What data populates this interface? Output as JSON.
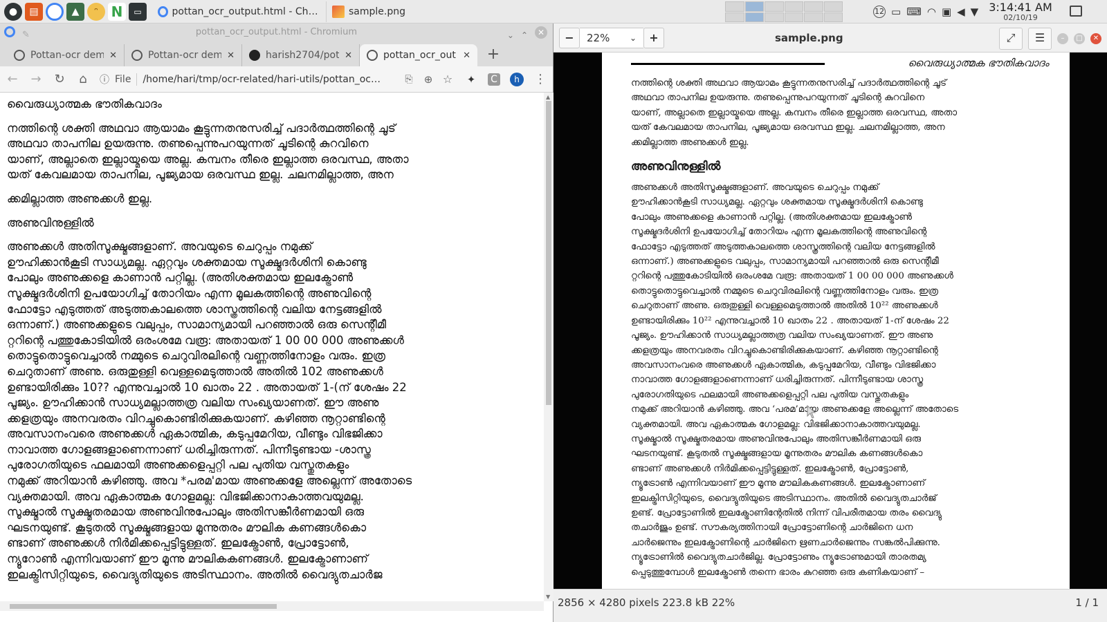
{
  "panel": {
    "tasks": [
      {
        "label": "pottan_ocr_output.html - Chromiu…"
      },
      {
        "label": "sample.png"
      }
    ],
    "battery_label": "12",
    "clock_time": "3:14:41 AM",
    "clock_date": "02/10/19"
  },
  "chromium": {
    "window_title": "pottan_ocr_output.html - Chromium",
    "tabs": [
      {
        "label": "Pottan-ocr dem"
      },
      {
        "label": "Pottan-ocr dem"
      },
      {
        "label": "harish2704/pot"
      },
      {
        "label": "pottan_ocr_out"
      }
    ],
    "scheme_label": "File",
    "url": "/home/hari/tmp/ocr-related/hari-utils/pottan_oc…",
    "avatar_letter": "h",
    "content": {
      "heading": "വൈരുധ്യാത്മക ഭൗതികവാദം",
      "p1": "നത്തിന്റെ ശക്തി അഥവാ ആയാമം കൂട്ടുന്നതനുസരിച്ച് പദാർത്ഥത്തിന്റെ ചൂട്\nഅഥവാ താപനില ഉയരുന്നു. തണുപ്പെന്നുപറയുന്നത് ചൂടിന്റെ കുറവിനെ\nയാണ്, അല്ലാതെ ഇല്ലായ്മയെ അല്ല. കമ്പനം തീരെ ഇല്ലാത്ത ഒരവസ്ഥ, അതാ\nയത് കേവലമായ താപനില, പൂജ്യമായ ഒരവസ്ഥ ഇല്ല. ചലനമില്ലാത്ത, അന",
      "p2": "ക്കമില്ലാത്ത അണുക്കൾ ഇല്ല.",
      "p3": "അണുവിനുള്ളിൽ",
      "p4": "അണുക്കൾ അതിസൂക്ഷ്മങ്ങളാണ്. അവയുടെ ചെറുപ്പം നമുക്ക്\nഊഹിക്കാൻകൂടി സാധ്യമല്ല. ഏറ്റവും ശക്തമായ സൂക്ഷ്മദർശിനി കൊണ്ടു\nപോലും അണുക്കളെ കാണാൻ പറ്റില്ല. (അതിശക്തമായ ഇലക്ട്രോൺ\nസൂക്ഷ്മദർശിനി ഉപയോഗിച്ച് തോറിയം എന്ന മൂലകത്തിന്റെ അണുവിന്റെ\nഫോട്ടോ എടുത്തത് അടുത്തകാലത്തെ ശാസ്ത്രത്തിന്റെ വലിയ നേട്ടങ്ങളിൽ\nഒന്നാണ്.) അണുക്കളുടെ വലുപ്പം, സാമാന്യമായി പറഞ്ഞാൽ ഒരു സെന്റീമീ\nറ്ററിന്റെ പത്തുകോടിയിൽ ഒരംശമേ വരൂ: അതായത് 1 00 00 000 അണുക്കൾ\nതൊട്ടുതൊട്ടുവെച്ചാൽ നമ്മുടെ ചെറുവിരലിന്റെ വണ്ണത്തിനോളം വരും. ഇത്ര\nചെറുതാണ് അണു. ഒരുതുള്ളി വെള്ളമെടുത്താൽ അതിൽ 102 അണുക്കൾ\nഉണ്ടായിരിക്കും 10?? എന്നുവച്ചാൽ 10 ഖാതം 22 . അതായത് 1-(ന് ശേഷം 22\nപൂജ്യം. ഊഹിക്കാൻ സാധ്യമല്ലാത്തത്ര വലിയ സംഖ്യയാണത്. ഈ അണു\nക്കളത്രയും അനവരതം വിറച്ചുകൊണ്ടിരിക്കുകയാണ്. കഴിഞ്ഞ നൂറ്റാണ്ടിന്റെ\nഅവസാനംവരെ അണുക്കൾ ഏകാത്മിക, കടുപ്പമേറിയ, വീണ്ടും വിഭജിക്കാ\nനാവാത്ത ഗോളങ്ങളാണെന്നാണ് ധരിച്ചിരുന്നത്. പിന്നീടുണ്ടായ -ശാസ്ത്ര\nപുരോഗതിയുടെ ഫലമായി അണുക്കളെപ്പറ്റി പല പുതിയ വസ്തുതകളും\nനമുക്ക് അറിയാൻ കഴിഞ്ഞു. അവ *പരമ'മായ അണുക്കളേ അല്ലെന്ന് അതോടെ\nവ്യക്തമായി. അവ ഏകാത്മക ഗോളമല്ല: വിഭജിക്കാനാകാത്തവയുമല്ല.\nസൂക്ഷ്മാൽ സൂക്ഷ്മതരമായ അണുവിനുപോലും അതിസങ്കീർണമായി ഒരു\nഘടനയുണ്ട്. കൂടുതൽ സൂക്ഷ്മങ്ങളായ മൂന്നുതരം മൗലിക കണങ്ങൾകൊ\nണ്ടാണ് അണുക്കൾ നിർമിക്കപ്പെട്ടിട്ടുള്ളത്. ഇലക്ട്രോൺ, പ്രോട്ടോൺ,\nന്യൂറോൺ എന്നിവയാണ് ഈ മൂന്നു മൗലികകണങ്ങൾ. ഇലക്ട്രോണാണ്\nഇലക്ട്രിസിറ്റിയുടെ, വൈദ്യുതിയുടെ അടിസ്ഥാനം. അതിൽ വൈദ്യുതചാർജ"
    }
  },
  "viewer": {
    "zoom": "22%",
    "title": "sample.png",
    "status_info": "2856 × 4280 pixels  223.8 kB   22%",
    "page_indicator": "1 / 1",
    "scan": {
      "header": "വൈരുധ്യാത്മക ഭൗതികവാദം",
      "p1": "നത്തിന്റെ ശക്തി അഥവാ ആയാമം കൂട്ടുന്നതനുസരിച്ച് പദാർത്ഥത്തിന്റെ ചൂട്\nഅഥവാ താപനില ഉയരുന്നു. തണുപ്പെന്നുപറയുന്നത് ചൂടിന്റെ കുറവിനെ\nയാണ്, അല്ലാതെ ഇല്ലായ്മയെ അല്ല. കമ്പനം തീരെ ഇല്ലാത്ത ഒരവസ്ഥ, അതാ\nയത് കേവലമായ താപനില, പൂജ്യമായ ഒരവസ്ഥ ഇല്ല. ചലനമില്ലാത്ത, അന\nക്കമില്ലാത്ത അണുക്കൾ ഇല്ല.",
      "section": "അണുവിനുള്ളിൽ",
      "p2": "        അണുക്കൾ അതിസൂക്ഷ്മങ്ങളാണ്. അവയുടെ ചെറുപ്പം നമുക്ക്\nഊഹിക്കാൻകൂടി സാധ്യമല്ല. ഏറ്റവും ശക്തമായ സൂക്ഷ്മദർശിനി കൊണ്ടു\nപോലും അണുക്കളെ കാണാൻ പറ്റില്ല. (അതിശക്തമായ ഇലക്ട്രോൺ\nസൂക്ഷ്മദർശിനി ഉപയോഗിച്ച് തോറിയം എന്ന മൂലകത്തിന്റെ അണുവിന്റെ\nഫോട്ടോ എടുത്തത് അടുത്തകാലത്തെ ശാസ്ത്രത്തിന്റെ വലിയ നേട്ടങ്ങളിൽ\nഒന്നാണ്.) അണുക്കളുടെ വലുപ്പം, സാമാന്യമായി പറഞ്ഞാൽ ഒരു സെന്റീമീ\nറ്ററിന്റെ പത്തുകോടിയിൽ ഒരംശമേ വരൂ: അതായത് 1 00 00 000 അണുക്കൾ\nതൊട്ടുതൊട്ടുവെച്ചാൽ നമ്മുടെ ചെറുവിരലിന്റെ വണ്ണത്തിനോളം വരും. ഇത്ര\nചെറുതാണ് അണു. ഒരുതുള്ളി വെള്ളമെടുത്താൽ അതിൽ 10²² അണുക്കൾ\nഉണ്ടായിരിക്കും 10²² എന്നുവച്ചാൽ 10 ഖാതം 22 . അതായത് 1-ന് ശേഷം 22\nപൂജ്യം. ഊഹിക്കാൻ സാധ്യമല്ലാത്തത്ര വലിയ സംഖ്യയാണത്. ഈ അണു\nക്കളത്രയും അനവരതം വിറച്ചുകൊണ്ടിരിക്കുകയാണ്. കഴിഞ്ഞ നൂറ്റാണ്ടിന്റെ\nഅവസാനംവരെ അണുക്കൾ ഏകാത്മിക, കടുപ്പമേറിയ, വീണ്ടും വിഭജിക്കാ\nനാവാത്ത ഗോളങ്ങളാണെന്നാണ് ധരിച്ചിരുന്നത്. പിന്നീടുണ്ടായ ശാസ്ത്ര\nപുരോഗതിയുടെ ഫലമായി അണുക്കളെപ്പറ്റി പല പുതിയ വസ്തുതകളും\nനമുക്ക് അറിയാൻ കഴിഞ്ഞു. അവ ‘പരമ’മായ അണുക്കളേ അല്ലെന്ന് അതോടെ\nവ്യക്തമായി. അവ ഏകാത്മക ഗോളമല്ല: വിഭജിക്കാനാകാത്തവയുമല്ല.\nസൂക്ഷ്മാൽ സൂക്ഷ്മതരമായ അണുവിനുപോലും അതിസങ്കീർണമായി ഒരു\nഘടനയുണ്ട്. കൂടുതൽ സൂക്ഷ്മങ്ങളായ മൂന്നുതരം മൗലിക കണങ്ങൾകൊ\nണ്ടാണ് അണുക്കൾ നിർമിക്കപ്പെട്ടിട്ടുള്ളത്. ഇലക്ട്രോൺ, പ്രോട്ടോൺ,\nന്യൂട്രോൺ എന്നിവയാണ് ഈ മൂന്നു മൗലികകണങ്ങൾ. ഇലക്ട്രോണാണ്\nഇലക്ട്രിസിറ്റിയുടെ, വൈദ്യുതിയുടെ അടിസ്ഥാനം. അതിൽ വൈദ്യുതചാർജ്\nഉണ്ട്. പ്രോട്ടോണിൽ ഇലക്ട്രോണിന്റേതിൽ നിന്ന് വിപരീതമായ തരം വൈദ്യു\nതചാർജും ഉണ്ട്. സൗകര്യത്തിനായി പ്രോട്ടോണിന്റെ ചാർജിനെ ധന\nചാർജെന്നും ഇലക്ട്രോണിന്റെ ചാർജിനെ ഋണചാർജെന്നും സങ്കൽപിക്കുന്നു.\nന്യൂട്രോണിൽ വൈദ്യുതചാർജില്ല. പ്രോട്ടോണും ന്യൂട്രോണുമായി താരതമ്യ\nപ്പെടുത്തുമ്പോൾ ഇലക്ട്രോൺ തന്നെ ഭാരം കുറഞ്ഞ ഒരു കണികയാണ് –"
    }
  }
}
